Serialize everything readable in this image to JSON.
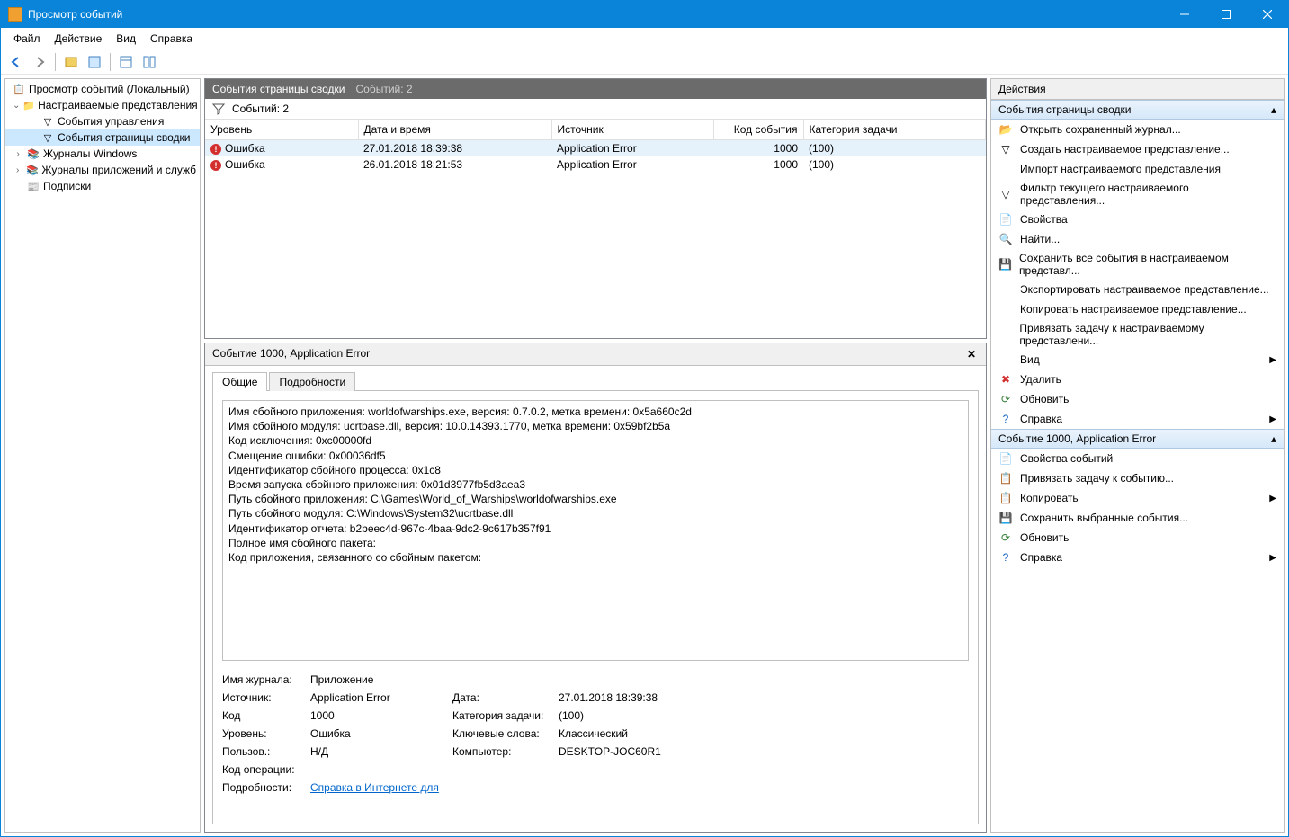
{
  "window": {
    "title": "Просмотр событий"
  },
  "menubar": [
    "Файл",
    "Действие",
    "Вид",
    "Справка"
  ],
  "tree": {
    "root": "Просмотр событий (Локальный)",
    "custom_views": "Настраиваемые представления",
    "admin_events": "События управления",
    "summary_events": "События страницы сводки",
    "windows_logs": "Журналы Windows",
    "app_service_logs": "Журналы приложений и служб",
    "subscriptions": "Подписки"
  },
  "events_header": {
    "title": "События страницы сводки",
    "count_label": "Событий: 2"
  },
  "filter_row": {
    "label": "Событий: 2"
  },
  "columns": {
    "level": "Уровень",
    "datetime": "Дата и время",
    "source": "Источник",
    "event_id": "Код события",
    "task_cat": "Категория задачи"
  },
  "events": [
    {
      "level": "Ошибка",
      "datetime": "27.01.2018 18:39:38",
      "source": "Application Error",
      "id": "1000",
      "cat": "(100)"
    },
    {
      "level": "Ошибка",
      "datetime": "26.01.2018 18:21:53",
      "source": "Application Error",
      "id": "1000",
      "cat": "(100)"
    }
  ],
  "detail": {
    "title": "Событие 1000, Application Error",
    "tabs": {
      "general": "Общие",
      "details": "Подробности"
    },
    "text": "Имя сбойного приложения: worldofwarships.exe, версия: 0.7.0.2, метка времени: 0x5a660c2d\nИмя сбойного модуля: ucrtbase.dll, версия: 10.0.14393.1770, метка времени: 0x59bf2b5a\nКод исключения: 0xc00000fd\nСмещение ошибки: 0x00036df5\nИдентификатор сбойного процесса: 0x1c8\nВремя запуска сбойного приложения: 0x01d3977fb5d3aea3\nПуть сбойного приложения: C:\\Games\\World_of_Warships\\worldofwarships.exe\nПуть сбойного модуля: C:\\Windows\\System32\\ucrtbase.dll\nИдентификатор отчета: b2beec4d-967c-4baa-9dc2-9c617b357f91\nПолное имя сбойного пакета:\nКод приложения, связанного со сбойным пакетом:",
    "labels": {
      "log": "Имя журнала:",
      "log_v": "Приложение",
      "src": "Источник:",
      "src_v": "Application Error",
      "date": "Дата:",
      "date_v": "27.01.2018 18:39:38",
      "code": "Код",
      "code_v": "1000",
      "cat": "Категория задачи:",
      "cat_v": "(100)",
      "lvl": "Уровень:",
      "lvl_v": "Ошибка",
      "kw": "Ключевые слова:",
      "kw_v": "Классический",
      "usr": "Пользов.:",
      "usr_v": "Н/Д",
      "comp": "Компьютер:",
      "comp_v": "DESKTOP-JOC60R1",
      "opcode": "Код операции:",
      "more": "Подробности:",
      "more_link": "Справка в Интернете для"
    }
  },
  "actions": {
    "title": "Действия",
    "sec1_title": "События страницы сводки",
    "sec1": [
      "Открыть сохраненный журнал...",
      "Создать настраиваемое представление...",
      "Импорт настраиваемого представления",
      "Фильтр текущего настраиваемого представления...",
      "Свойства",
      "Найти...",
      "Сохранить все события в настраиваемом представл...",
      "Экспортировать настраиваемое представление...",
      "Копировать настраиваемое представление...",
      "Привязать задачу к настраиваемому представлени...",
      "Вид",
      "Удалить",
      "Обновить",
      "Справка"
    ],
    "sec2_title": "Событие 1000, Application Error",
    "sec2": [
      "Свойства событий",
      "Привязать задачу к событию...",
      "Копировать",
      "Сохранить выбранные события...",
      "Обновить",
      "Справка"
    ]
  }
}
